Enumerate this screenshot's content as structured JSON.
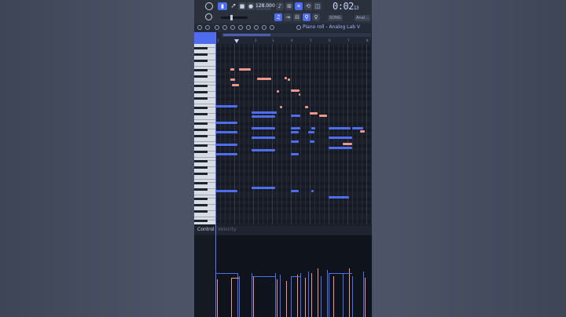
{
  "toolbar": {
    "tempo": "128.000",
    "time_main": "0:02",
    "time_sub": "13",
    "tag_mode": "SONG",
    "tag_track": "Anal..."
  },
  "piano_roll": {
    "title": "Piano roll - Analog Lab V",
    "bars": [
      "1",
      "2",
      "3",
      "4",
      "5",
      "6",
      "7",
      "8"
    ]
  },
  "control": {
    "label": "Control",
    "sub_label": "Velocity"
  },
  "colors": {
    "accent": "#4d6cf0",
    "note_blue": "#4f6df2",
    "note_pink": "#f0958a",
    "key_highlight": "#f29a3a"
  }
}
